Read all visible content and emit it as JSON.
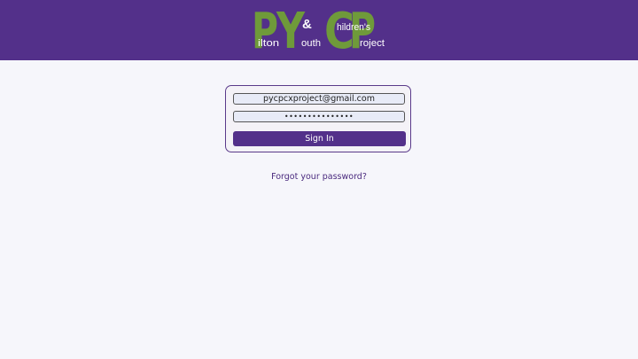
{
  "header": {
    "logo": {
      "big_letters": [
        "P",
        "Y",
        "C",
        "P"
      ],
      "ampersand": "&",
      "words": {
        "pilton": "ilton",
        "youth": "outh",
        "childrens": "hildren's",
        "project": "roject"
      }
    }
  },
  "login": {
    "email_value": "pycpcxproject@gmail.com",
    "password_value": "•••••••••••••••",
    "signin_label": "Sign In"
  },
  "forgot_label": "Forgot your password?",
  "colors": {
    "brand_purple": "#53308a",
    "logo_green": "#6f9a3a",
    "background": "#f6f6fb"
  }
}
